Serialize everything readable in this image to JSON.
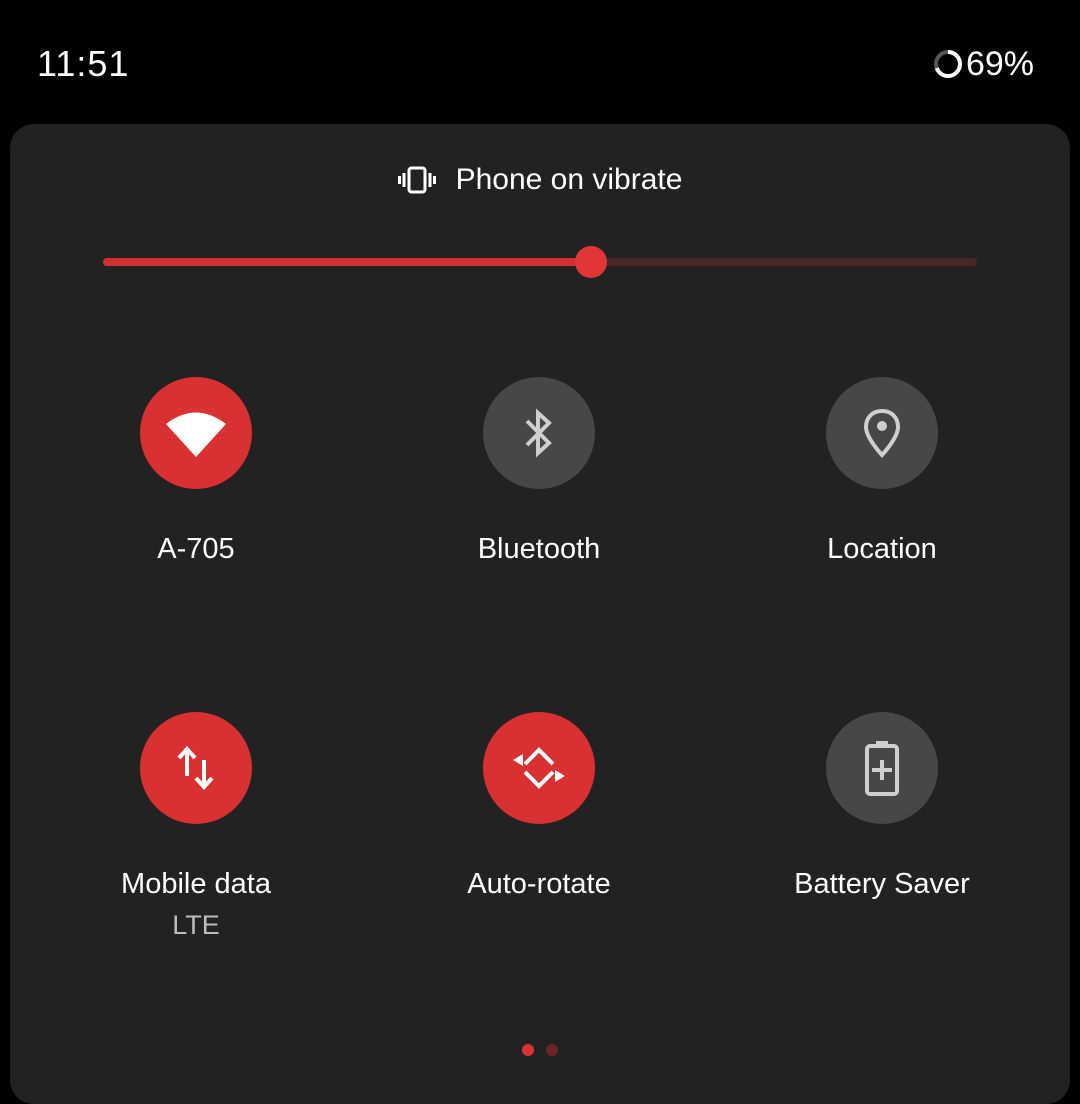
{
  "status_bar": {
    "time": "11:51",
    "battery_percent": "69%",
    "battery_level": 0.69
  },
  "ringer": {
    "label": "Phone on vibrate",
    "icon": "vibrate-icon"
  },
  "brightness_slider": {
    "level": 0.558
  },
  "tiles": [
    {
      "label": "A-705",
      "icon": "wifi-icon",
      "state": "on"
    },
    {
      "label": "Bluetooth",
      "icon": "bluetooth-icon",
      "state": "off"
    },
    {
      "label": "Location",
      "icon": "location-pin-icon",
      "state": "off"
    },
    {
      "label": "Mobile data",
      "sublabel": "LTE",
      "icon": "mobile-data-arrows-icon",
      "state": "on"
    },
    {
      "label": "Auto-rotate",
      "icon": "auto-rotate-icon",
      "state": "on"
    },
    {
      "label": "Battery Saver",
      "icon": "battery-saver-icon",
      "state": "off"
    }
  ],
  "pagination": {
    "current_page": 1,
    "total_pages": 2
  },
  "colors": {
    "accent": "#d93131",
    "tile_off": "#474747",
    "panel_background": "#222222",
    "dot_inactive": "#6b2424"
  }
}
